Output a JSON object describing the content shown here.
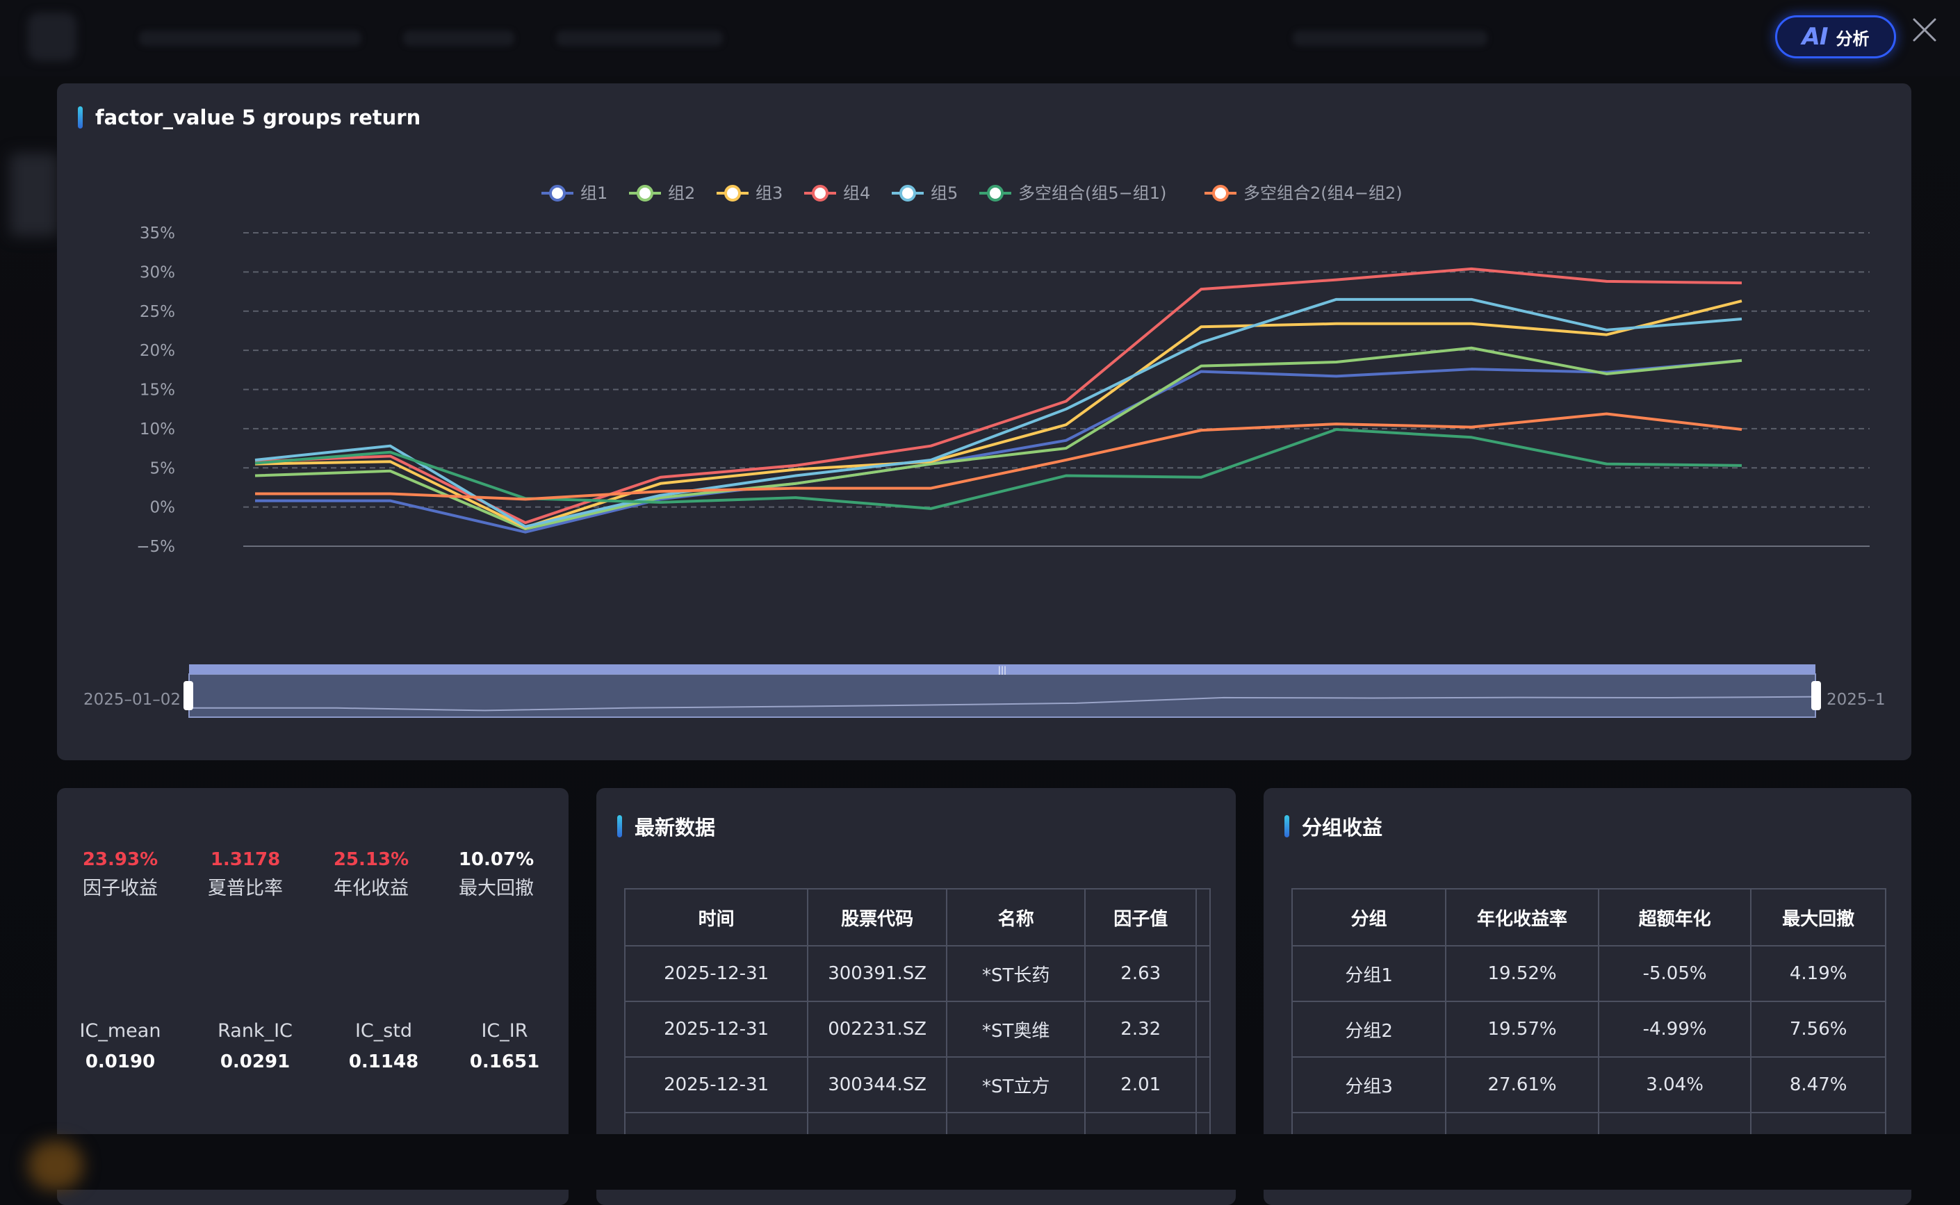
{
  "toolbar": {
    "ai_glyph": "AI",
    "ai_label": "分析"
  },
  "chart_panel": {
    "title": "factor_value 5 groups return"
  },
  "chart_data": {
    "type": "line",
    "title": "factor_value 5 groups return",
    "y_ticks": [
      "35%",
      "30%",
      "25%",
      "20%",
      "15%",
      "10%",
      "5%",
      "0%",
      "−5%"
    ],
    "ylim": [
      -5,
      35
    ],
    "grid": true,
    "legend_position": "top-center",
    "x_points": 12,
    "range_start_label": "2025–01–02",
    "range_end_label": "2025–1",
    "series": [
      {
        "name": "组1",
        "color": "#5470c6",
        "values": [
          0.8,
          0.8,
          -3.2,
          1.0,
          3.0,
          5.5,
          8.5,
          17.3,
          16.7,
          17.6,
          17.2,
          18.7
        ]
      },
      {
        "name": "组2",
        "color": "#91cc75",
        "values": [
          4.0,
          4.6,
          -2.8,
          1.2,
          3.0,
          5.5,
          7.5,
          18.0,
          18.5,
          20.3,
          17.0,
          18.7
        ]
      },
      {
        "name": "组3",
        "color": "#fac858",
        "values": [
          5.5,
          5.8,
          -2.6,
          3.0,
          4.8,
          5.8,
          10.5,
          23.0,
          23.4,
          23.4,
          22.0,
          26.3
        ]
      },
      {
        "name": "组4",
        "color": "#ee6666",
        "values": [
          5.8,
          6.5,
          -2.0,
          3.8,
          5.3,
          7.8,
          13.5,
          27.8,
          29.0,
          30.4,
          28.8,
          28.6
        ]
      },
      {
        "name": "组5",
        "color": "#73c0de",
        "values": [
          6.0,
          7.8,
          -2.5,
          1.5,
          4.0,
          6.0,
          12.5,
          21.0,
          26.5,
          26.5,
          22.6,
          24.0
        ]
      },
      {
        "name": "多空组合(组5−组1)",
        "color": "#3ba272",
        "values": [
          5.6,
          7.0,
          1.1,
          0.6,
          1.2,
          -0.2,
          4.0,
          3.8,
          9.9,
          8.9,
          5.5,
          5.3
        ]
      },
      {
        "name": "多空组合2(组4−组2)",
        "color": "#fc8452",
        "values": [
          1.7,
          1.7,
          1.0,
          2.0,
          2.4,
          2.4,
          6.0,
          9.8,
          10.6,
          10.2,
          11.9,
          9.9
        ]
      }
    ]
  },
  "stats": {
    "top": [
      {
        "value": "23.93%",
        "label": "因子收益",
        "color": "red"
      },
      {
        "value": "1.3178",
        "label": "夏普比率",
        "color": "red"
      },
      {
        "value": "25.13%",
        "label": "年化收益",
        "color": "red"
      },
      {
        "value": "10.07%",
        "label": "最大回撤",
        "color": "white"
      }
    ],
    "ic": [
      {
        "label": "IC_mean",
        "value": "0.0190"
      },
      {
        "label": "Rank_IC",
        "value": "0.0291"
      },
      {
        "label": "IC_std",
        "value": "0.1148"
      },
      {
        "label": "IC_IR",
        "value": "0.1651"
      }
    ]
  },
  "latest": {
    "title": "最新数据",
    "headers": [
      "时间",
      "股票代码",
      "名称",
      "因子值"
    ],
    "rows": [
      [
        "2025-12-31",
        "300391.SZ",
        "*ST长药",
        "2.63"
      ],
      [
        "2025-12-31",
        "002231.SZ",
        "*ST奥维",
        "2.32"
      ],
      [
        "2025-12-31",
        "300344.SZ",
        "*ST立方",
        "2.01"
      ]
    ]
  },
  "groups": {
    "title": "分组收益",
    "headers": [
      "分组",
      "年化收益率",
      "超额年化",
      "最大回撤"
    ],
    "rows": [
      [
        "分组1",
        "19.52%",
        "-5.05%",
        "4.19%"
      ],
      [
        "分组2",
        "19.57%",
        "-4.99%",
        "7.56%"
      ],
      [
        "分组3",
        "27.61%",
        "3.04%",
        "8.47%"
      ]
    ]
  }
}
